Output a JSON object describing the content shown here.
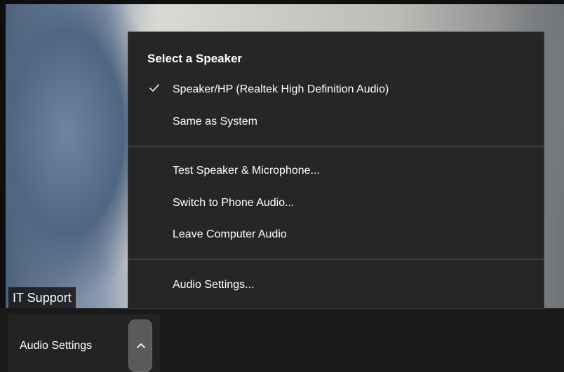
{
  "video": {
    "participant_name": "IT Support"
  },
  "toolbar": {
    "audio_label": "Audio Settings",
    "caret_icon": "chevron-up-icon"
  },
  "speaker_menu": {
    "heading": "Select a Speaker",
    "speakers": [
      {
        "label": "Speaker/HP (Realtek High Definition Audio)",
        "selected": true
      },
      {
        "label": "Same as System",
        "selected": false
      }
    ],
    "actions": [
      {
        "label": "Test Speaker & Microphone..."
      },
      {
        "label": "Switch to Phone Audio..."
      },
      {
        "label": "Leave Computer Audio"
      }
    ],
    "settings": {
      "label": "Audio Settings..."
    }
  },
  "colors": {
    "menu_background": "#262626",
    "toolbar_background": "#1a1a1a",
    "text": "#ffffff"
  }
}
